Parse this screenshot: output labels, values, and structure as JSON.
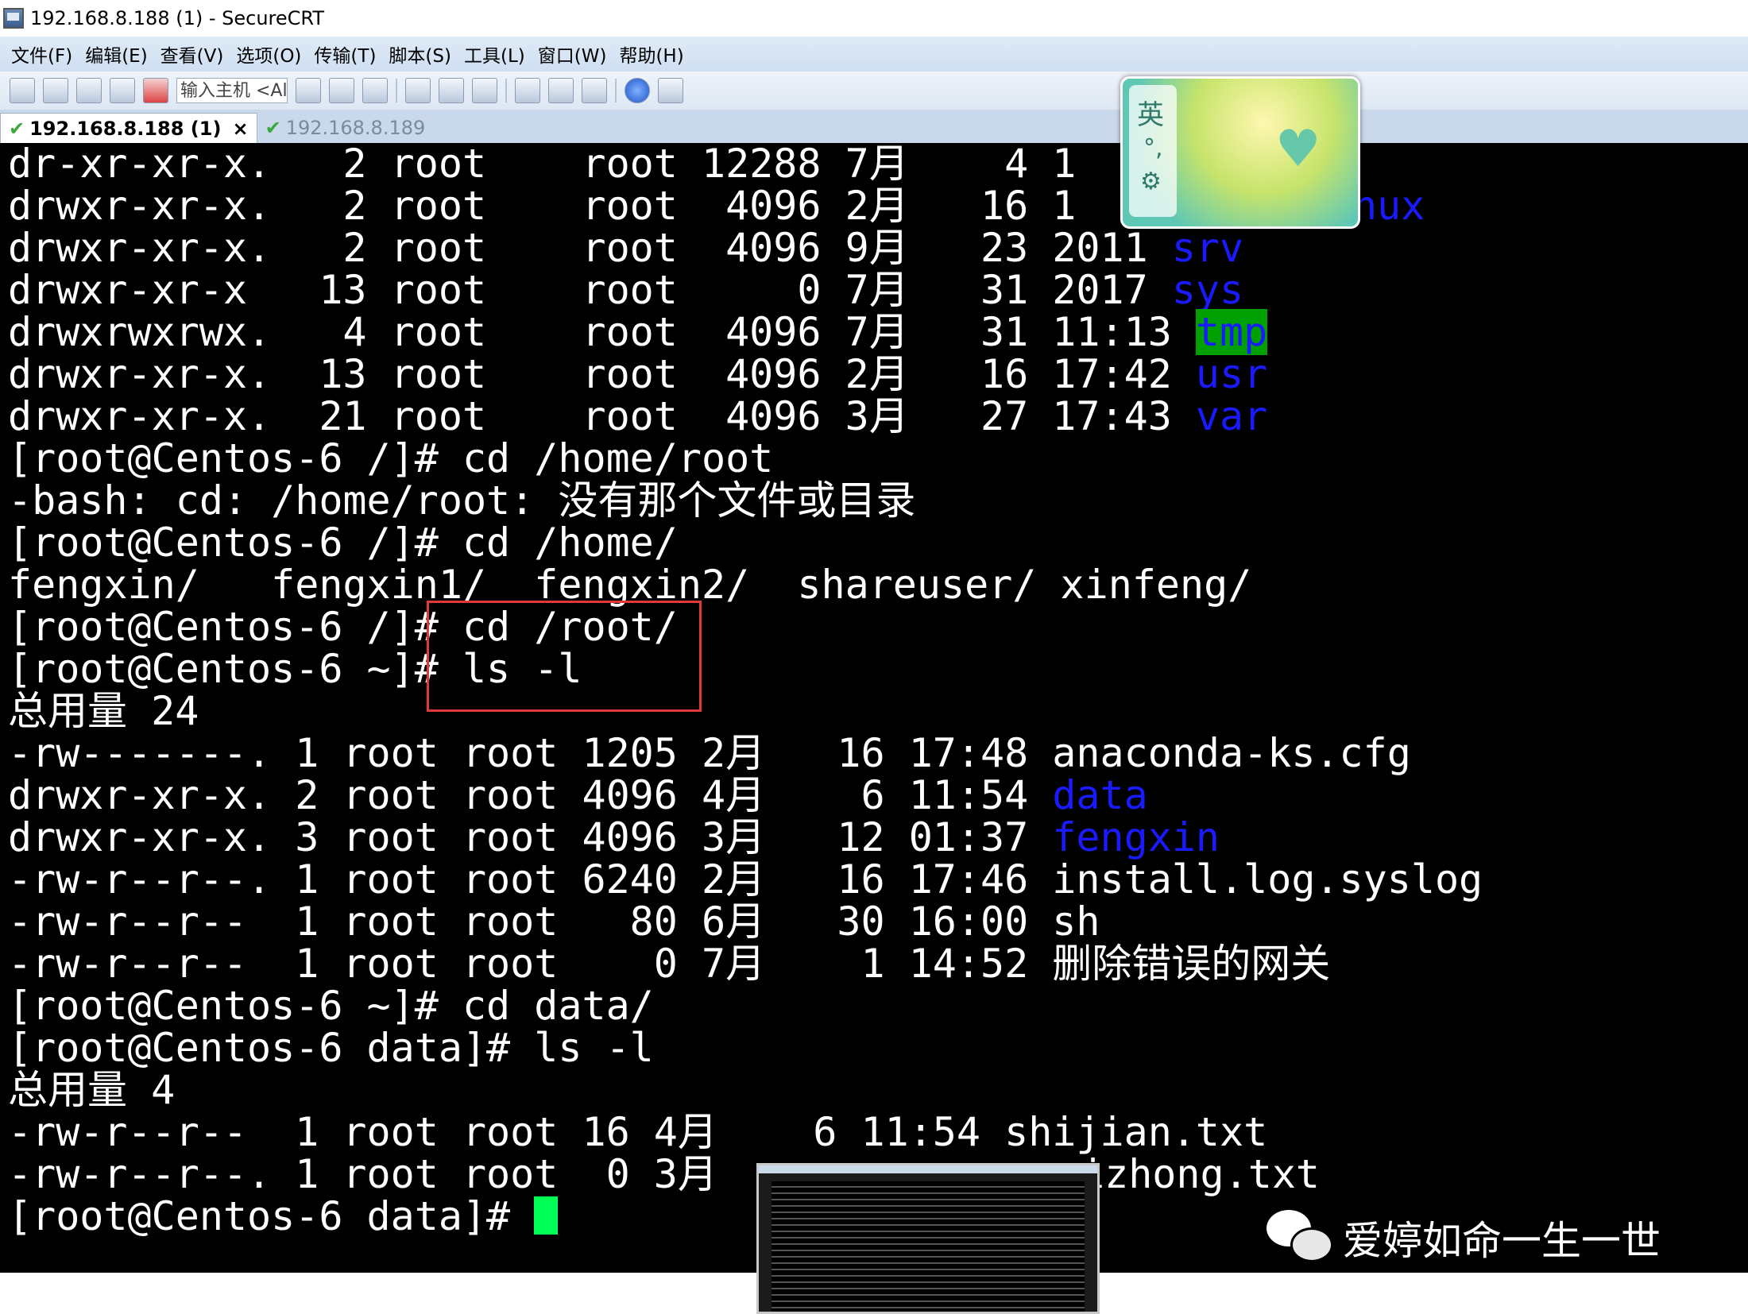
{
  "window": {
    "title": "192.168.8.188 (1) - SecureCRT"
  },
  "menu": [
    "文件(F)",
    "编辑(E)",
    "查看(V)",
    "选项(O)",
    "传输(T)",
    "脚本(S)",
    "工具(L)",
    "窗口(W)",
    "帮助(H)"
  ],
  "toolbar": {
    "host_input_value": "输入主机 <Al"
  },
  "tabs": {
    "active": "192.168.8.188 (1)",
    "inactive": "192.168.8.189",
    "close_symbol": "×",
    "check_symbol": "✔"
  },
  "terminal": {
    "lines": [
      {
        "text": "dr-xr-xr-x.   2 root    root 12288 7月    4 1",
        "colored": "",
        "tail": ""
      },
      {
        "text": "drwxr-xr-x.   2 root    root  4096 2月   16 1",
        "colored": "",
        "tail": ""
      },
      {
        "text": "drwxr-xr-x.   2 root    root  4096 9月   23 2011 ",
        "colored": "srv",
        "tail": ""
      },
      {
        "text": "drwxr-xr-x   13 root    root     0 7月   31 2017 ",
        "colored": "sys",
        "tail": ""
      },
      {
        "text": "drwxrwxrwx.   4 root    root  4096 7月   31 11:13 ",
        "colored": "tmp",
        "tail": ""
      },
      {
        "text": "drwxr-xr-x.  13 root    root  4096 2月   16 17:42 ",
        "colored": "usr",
        "tail": ""
      },
      {
        "text": "drwxr-xr-x.  21 root    root  4096 3月   27 17:43 ",
        "colored": "var",
        "tail": ""
      },
      {
        "text": "[root@Centos-6 /]# cd /home/root",
        "colored": "",
        "tail": ""
      },
      {
        "text": "-bash: cd: /home/root: 没有那个文件或目录",
        "colored": "",
        "tail": ""
      },
      {
        "text": "[root@Centos-6 /]# cd /home/",
        "colored": "",
        "tail": ""
      },
      {
        "text": "fengxin/   fengxin1/  fengxin2/  shareuser/ xinfeng/",
        "colored": "",
        "tail": ""
      },
      {
        "text": "[root@Centos-6 /]# cd /root/",
        "colored": "",
        "tail": ""
      },
      {
        "text": "[root@Centos-6 ~]# ls -l",
        "colored": "",
        "tail": ""
      },
      {
        "text": "总用量 24",
        "colored": "",
        "tail": ""
      },
      {
        "text": "-rw-------. 1 root root 1205 2月   16 17:48 anaconda-ks.cfg",
        "colored": "",
        "tail": ""
      },
      {
        "text": "drwxr-xr-x. 2 root root 4096 4月    6 11:54 ",
        "colored": "data",
        "tail": ""
      },
      {
        "text": "drwxr-xr-x. 3 root root 4096 3月   12 01:37 ",
        "colored": "fengxin",
        "tail": ""
      },
      {
        "text": "-rw-r--r--. 1 root root 6240 2月   16 17:46 install.log.syslog",
        "colored": "",
        "tail": ""
      },
      {
        "text": "-rw-r--r--  1 root root   80 6月   30 16:00 sh",
        "colored": "",
        "tail": ""
      },
      {
        "text": "-rw-r--r--  1 root root    0 7月    1 14:52 删除错误的网关",
        "colored": "",
        "tail": ""
      },
      {
        "text": "[root@Centos-6 ~]# cd data/",
        "colored": "",
        "tail": ""
      },
      {
        "text": "[root@Centos-6 data]# ls -l",
        "colored": "",
        "tail": ""
      },
      {
        "text": "总用量 4",
        "colored": "",
        "tail": ""
      },
      {
        "text": "-rw-r--r--  1 root root 16 4月    6 11:54 shijian.txt",
        "colored": "",
        "tail": ""
      },
      {
        "text": "-rw-r--r--. 1 root root  0 3月",
        "colored": "",
        "tail": "izhong.txt"
      },
      {
        "text": "[root@Centos-6 data]# ",
        "colored": "",
        "tail": ""
      }
    ],
    "partial_overlap_word": "nux"
  },
  "ime": {
    "char": "英",
    "dots": "°,",
    "gear": "⚙",
    "heart": "♥"
  },
  "watermark": {
    "text": "爱婷如命一生一世"
  },
  "colors": {
    "terminal_bg": "#000000",
    "dir_blue": "#1a1aff",
    "tmp_bg": "#00a000",
    "cursor": "#00ff55",
    "highlight_box": "#e0393b"
  }
}
